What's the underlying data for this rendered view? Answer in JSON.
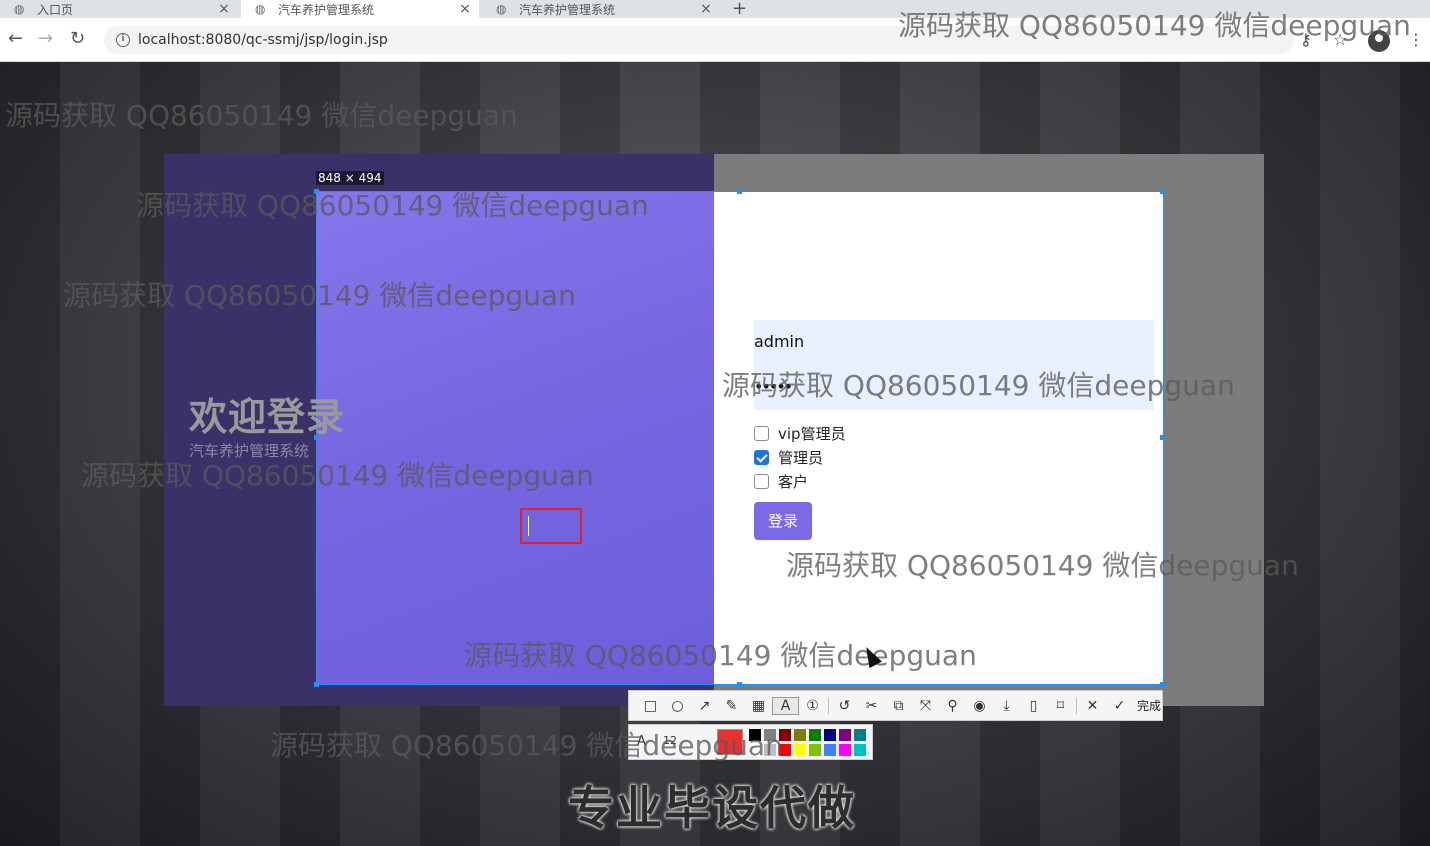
{
  "browser": {
    "tabs": [
      {
        "label": "入口页"
      },
      {
        "label": "汽车养护管理系统"
      },
      {
        "label": "汽车养护管理系统"
      }
    ],
    "new_tab": "+",
    "url": "localhost:8080/qc-ssmj/jsp/login.jsp"
  },
  "capture": {
    "size_label": "848 × 494",
    "done_label": "完成",
    "font_label": "A",
    "font_size": "12",
    "selected_color": "#e83030",
    "swatches": [
      "#000000",
      "#808080",
      "#800000",
      "#808000",
      "#008000",
      "#000080",
      "#800080",
      "#008080",
      "#ffffff",
      "#c0c0c0",
      "#ff0000",
      "#ffff00",
      "#80c000",
      "#4080ff",
      "#ff00ff",
      "#00c0c0"
    ]
  },
  "login": {
    "welcome": "欢迎登录",
    "subtitle": "汽车养护管理系统",
    "username_value": "admin",
    "password_value": "•••••",
    "roles": [
      {
        "label": "vip管理员",
        "checked": false
      },
      {
        "label": "管理员",
        "checked": true
      },
      {
        "label": "客户",
        "checked": false
      }
    ],
    "login_button": "登录"
  },
  "watermark_text": "源码获取 QQ86050149 微信deepguan",
  "caption": "专业毕设代做",
  "accent": "#7a6ae6"
}
